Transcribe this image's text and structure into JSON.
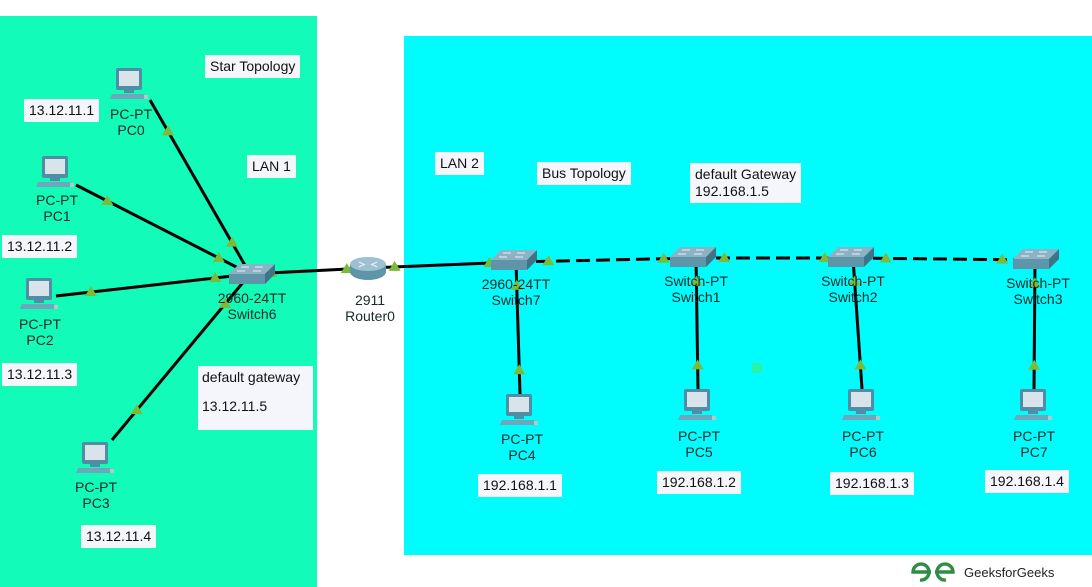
{
  "colors": {
    "lan1_bg": "#12fbb9",
    "lan2_bg": "#00fdfd",
    "link": "#000000",
    "link_light": "#7cbb3a",
    "brand": "#2f8d46"
  },
  "notes": {
    "star_topology": "Star Topology",
    "lan1": "LAN 1",
    "lan2": "LAN 2",
    "bus_topology": "Bus Topology",
    "gw1_title": "default gateway",
    "gw1_ip": "13.12.11.5",
    "gw2_title": "default Gateway",
    "gw2_ip": "192.168.1.5"
  },
  "devices": {
    "pc0": {
      "model": "PC-PT",
      "name": "PC0",
      "ip": "13.12.11.1"
    },
    "pc1": {
      "model": "PC-PT",
      "name": "PC1",
      "ip": "13.12.11.2"
    },
    "pc2": {
      "model": "PC-PT",
      "name": "PC2",
      "ip": "13.12.11.3"
    },
    "pc3": {
      "model": "PC-PT",
      "name": "PC3",
      "ip": "13.12.11.4"
    },
    "switch6": {
      "model": "2960-24TT",
      "name": "Switch6"
    },
    "router0": {
      "model": "2911",
      "name": "Router0"
    },
    "switch7": {
      "model": "2960-24TT",
      "name": "Switch7"
    },
    "switch1": {
      "model": "Switch-PT",
      "name": "Switch1"
    },
    "switch2": {
      "model": "Switch-PT",
      "name": "Switch2"
    },
    "switch3": {
      "model": "Switch-PT",
      "name": "Switch3"
    },
    "pc4": {
      "model": "PC-PT",
      "name": "PC4",
      "ip": "192.168.1.1"
    },
    "pc5": {
      "model": "PC-PT",
      "name": "PC5",
      "ip": "192.168.1.2"
    },
    "pc6": {
      "model": "PC-PT",
      "name": "PC6",
      "ip": "192.168.1.3"
    },
    "pc7": {
      "model": "PC-PT",
      "name": "PC7",
      "ip": "192.168.1.4"
    }
  },
  "links": [
    {
      "from": "pc0",
      "to": "switch6",
      "style": "solid"
    },
    {
      "from": "pc1",
      "to": "switch6",
      "style": "solid"
    },
    {
      "from": "pc2",
      "to": "switch6",
      "style": "solid"
    },
    {
      "from": "pc3",
      "to": "switch6",
      "style": "solid"
    },
    {
      "from": "switch6",
      "to": "router0",
      "style": "solid"
    },
    {
      "from": "router0",
      "to": "switch7",
      "style": "solid"
    },
    {
      "from": "switch7",
      "to": "switch1",
      "style": "dashed"
    },
    {
      "from": "switch1",
      "to": "switch2",
      "style": "dashed"
    },
    {
      "from": "switch2",
      "to": "switch3",
      "style": "dashed"
    },
    {
      "from": "switch7",
      "to": "pc4",
      "style": "solid"
    },
    {
      "from": "switch1",
      "to": "pc5",
      "style": "solid"
    },
    {
      "from": "switch2",
      "to": "pc6",
      "style": "solid"
    },
    {
      "from": "switch3",
      "to": "pc7",
      "style": "solid"
    }
  ],
  "watermark": {
    "brand": "GeeksforGeeks"
  }
}
